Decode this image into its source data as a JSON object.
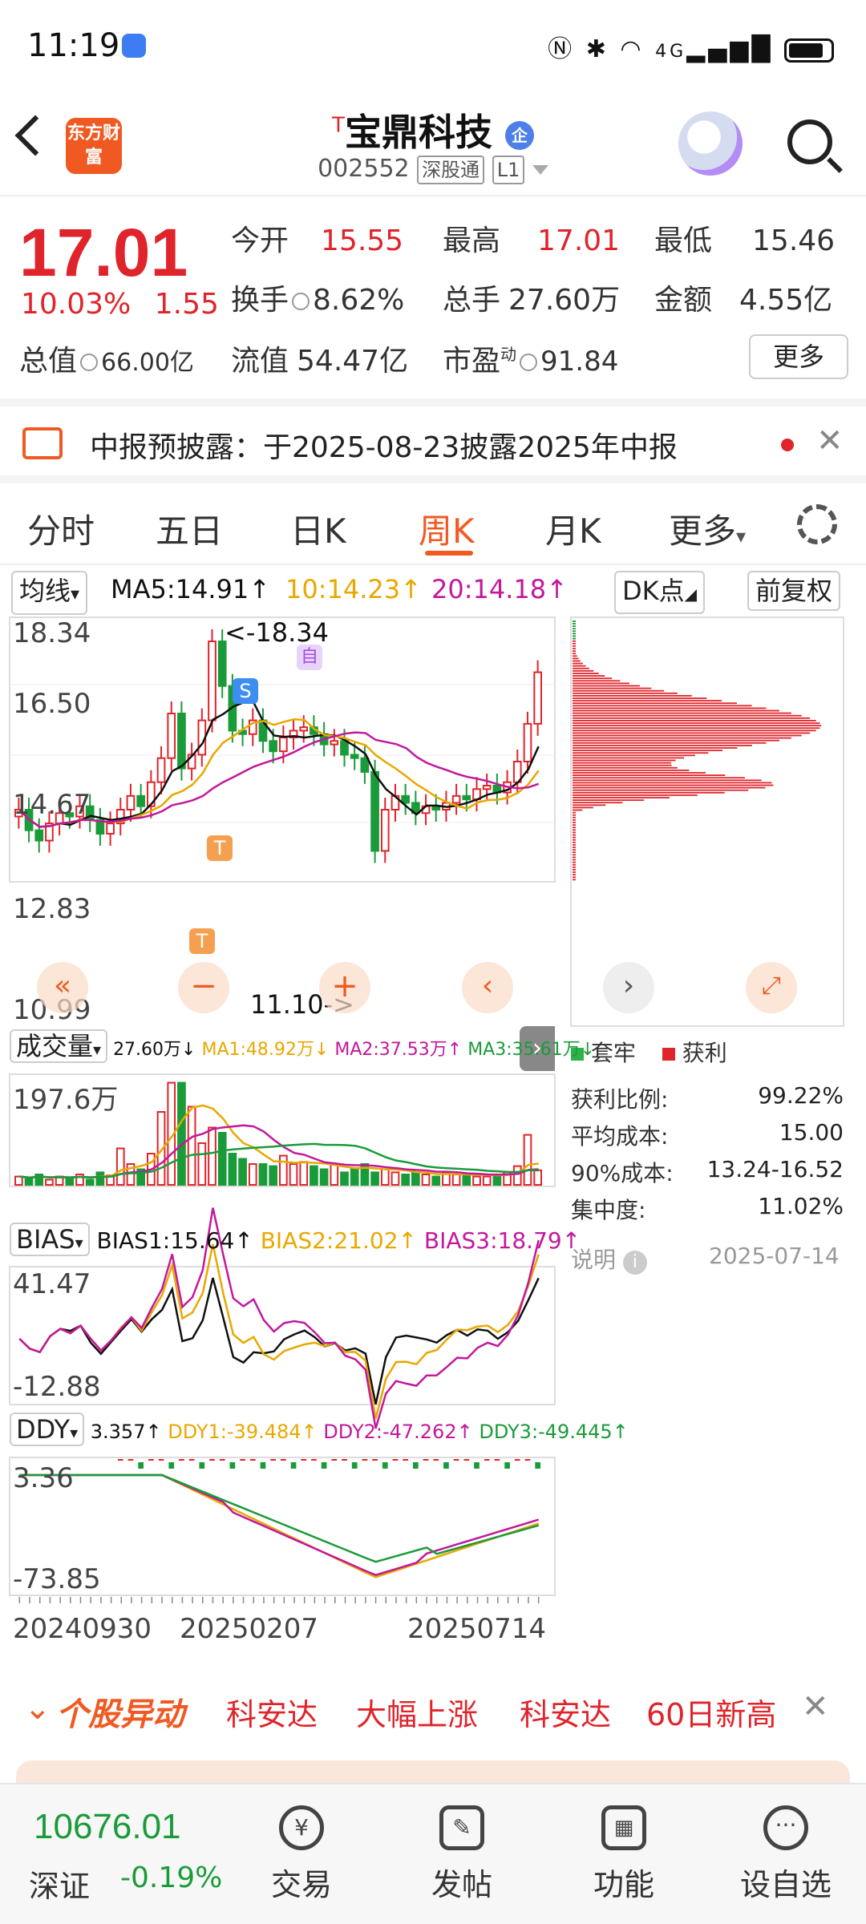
{
  "status_bar": {
    "time": "11:19",
    "icons": [
      "nfc-icon",
      "bluetooth-icon",
      "wifi-icon",
      "4g-signal-icon",
      "battery-icon"
    ],
    "network": "4G"
  },
  "header": {
    "logo_text": "东方财富",
    "stock_prefix": "T",
    "stock_name": "宝鼎科技",
    "badge": "企",
    "code": "002552",
    "tag1": "深股通",
    "tag2": "L1"
  },
  "quote": {
    "price": "17.01",
    "change_pct": "10.03%",
    "change_amt": "1.55",
    "rows": [
      [
        {
          "label": "今开",
          "value": "15.55",
          "color": "red"
        },
        {
          "label": "最高",
          "value": "17.01",
          "color": "red"
        },
        {
          "label": "最低",
          "value": "15.46",
          "color": "black"
        }
      ],
      [
        {
          "label": "换手",
          "value": "8.62%",
          "color": "black"
        },
        {
          "label": "总手",
          "value": "27.60万",
          "color": "black"
        },
        {
          "label": "金额",
          "value": "4.55亿",
          "color": "black"
        }
      ],
      [
        {
          "label": "总值",
          "value": "66.00亿",
          "color": "black"
        },
        {
          "label": "流值",
          "value": "54.47亿",
          "color": "black"
        },
        {
          "label": "市盈",
          "sup": "动",
          "value": "91.84",
          "color": "black"
        }
      ]
    ],
    "more_label": "更多"
  },
  "notice": {
    "text": "中报预披露：于2025-08-23披露2025年中报"
  },
  "tabs": {
    "items": [
      "分时",
      "五日",
      "日K",
      "周K",
      "月K",
      "更多"
    ],
    "active": "周K"
  },
  "ma_row": {
    "selector": "均线",
    "ma5": "MA5:14.91↑",
    "ma10": "10:14.23↑",
    "ma20": "20:14.18↑",
    "dk": "DK点",
    "adjust": "前复权"
  },
  "kline": {
    "y_labels": [
      "18.34",
      "16.50",
      "14.67",
      "12.83",
      "10.99"
    ],
    "high_marker": "<-18.34",
    "low_marker": "11.10->",
    "markers": [
      "S",
      "自",
      "T",
      "T"
    ]
  },
  "volume": {
    "selector": "成交量",
    "vol": "27.60万↓",
    "ma1": "MA1:48.92万↓",
    "ma2": "MA2:37.53万↑",
    "ma3": "MA3:35.61万↓",
    "max_label": "197.6万"
  },
  "bias": {
    "selector": "BIAS",
    "b1": "BIAS1:15.64↑",
    "b2": "BIAS2:21.02↑",
    "b3": "BIAS3:18.79↑",
    "max": "41.47",
    "min": "-12.88"
  },
  "ddy": {
    "selector": "DDY",
    "v": "3.357↑",
    "d1": "DDY1:-39.484↑",
    "d2": "DDY2:-47.262↑",
    "d3": "DDY3:-49.445↑",
    "max": "3.36",
    "min": "-73.85"
  },
  "x_dates": [
    "20240930",
    "20250207",
    "20250714"
  ],
  "chips": {
    "legend_trapped": "套牢",
    "legend_profit": "获利",
    "rows": [
      {
        "label": "获利比例:",
        "value": "99.22%"
      },
      {
        "label": "平均成本:",
        "value": "15.00"
      },
      {
        "label": "90%成本:",
        "value": "13.24-16.52"
      },
      {
        "label": "集中度:",
        "value": "11.02%"
      }
    ],
    "note": "说明",
    "date": "2025-07-14"
  },
  "alert": {
    "title": "个股异动",
    "items": [
      "科安达",
      "大幅上涨",
      "科安达",
      "60日新高"
    ]
  },
  "bottom": {
    "index_value": "10676.01",
    "index_name": "深证",
    "index_change": "-0.19%",
    "nav": [
      "交易",
      "发帖",
      "功能",
      "设自选"
    ]
  },
  "colors": {
    "up": "#e0242b",
    "down": "#1a9b3a",
    "accent": "#f05a22",
    "ma5": "#111111",
    "ma10": "#e8a800",
    "ma20": "#c2189c"
  }
}
